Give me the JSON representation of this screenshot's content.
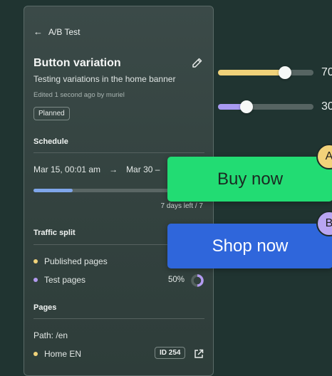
{
  "header": {
    "back_label": "A/B Test"
  },
  "test": {
    "title": "Button variation",
    "description": "Testing variations in the home banner",
    "edited": "Edited 1 second ago by muriel",
    "status": "Planned"
  },
  "schedule": {
    "heading": "Schedule",
    "start": "Mar 15, 00:01 am",
    "arrow": "→",
    "end": "Mar 30 –",
    "progress": 0.23,
    "days_left": "7 days left / 7"
  },
  "traffic": {
    "heading": "Traffic split",
    "items": [
      {
        "label": "Published pages",
        "color": "#f0d27a"
      },
      {
        "label": "Test pages",
        "color": "#b39af0",
        "percent": "50%"
      }
    ]
  },
  "pages": {
    "heading": "Pages",
    "path": "Path: /en",
    "items": [
      {
        "label": "Home EN",
        "id": "ID 254",
        "color": "#f0d27a"
      }
    ]
  },
  "sliders": [
    {
      "value_text": "70",
      "fraction": 0.7,
      "color": "#f0d27a"
    },
    {
      "value_text": "30",
      "fraction": 0.3,
      "color": "#a89af2"
    }
  ],
  "variants": [
    {
      "button_label": "Buy now",
      "tag": "A",
      "button_color": "#22dc73",
      "tag_color": "#f3d27a",
      "text_color": "#1a2a22"
    },
    {
      "button_label": "Shop now",
      "tag": "B",
      "button_color": "#2f66db",
      "tag_color": "#b9a6f2",
      "text_color": "#ffffff"
    }
  ]
}
